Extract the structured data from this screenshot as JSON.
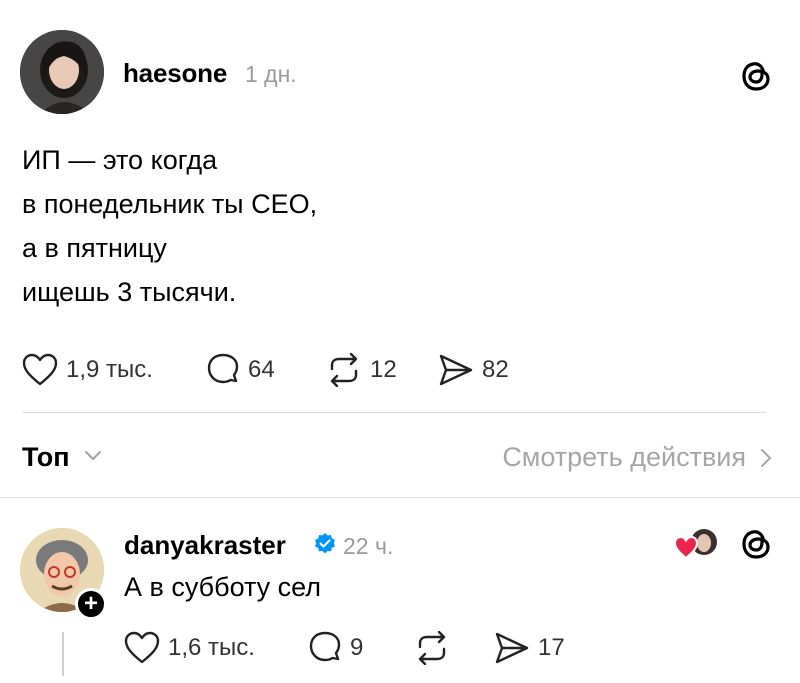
{
  "post": {
    "username": "haesone",
    "time": "1 дн.",
    "text_lines": [
      "ИП — это когда",
      "в понедельник ты CEO,",
      "а в пятницу",
      "ищешь 3 тысячи."
    ],
    "likes": "1,9 тыс.",
    "comments": "64",
    "reposts": "12",
    "shares": "82"
  },
  "sort": {
    "label": "Топ",
    "activity_link": "Смотреть действия"
  },
  "reply": {
    "username": "danyakraster",
    "verified": true,
    "time": "22 ч.",
    "text": "А в субботу сел",
    "likes": "1,6 тыс.",
    "comments": "9",
    "reposts": "",
    "shares": "17",
    "follow_badge": "+"
  },
  "icons": {
    "threads": "threads-logo-icon",
    "like": "heart-outline-icon",
    "comment": "speech-bubble-icon",
    "repost": "repost-arrows-icon",
    "share": "paper-plane-icon",
    "verified": "verified-badge-icon",
    "liked_by_author": "heart-avatar-icon"
  },
  "colors": {
    "text": "#000000",
    "muted": "#9a9a9a",
    "verified": "#0095f6",
    "liked_heart": "#e8254b",
    "divider": "#dcdcdc"
  }
}
